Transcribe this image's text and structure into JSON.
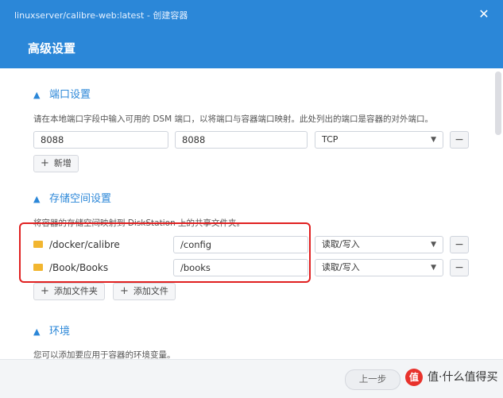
{
  "window": {
    "title": "linuxserver/calibre-web:latest - 创建容器"
  },
  "header": {
    "title": "高级设置"
  },
  "port_section": {
    "title": "端口设置",
    "description": "请在本地端口字段中输入可用的 DSM 端口，以将端口与容器端口映射。此处列出的端口是容器的对外端口。",
    "local_port": "8088",
    "container_port": "8088",
    "protocol": "TCP",
    "add_label": "新增"
  },
  "storage_section": {
    "title": "存储空间设置",
    "description": "将容器的存储空间映射到 DiskStation 上的共享文件夹。",
    "rows": [
      {
        "folder": "/docker/calibre",
        "mount": "/config",
        "mode": "读取/写入"
      },
      {
        "folder": "/Book/Books",
        "mount": "/books",
        "mode": "读取/写入"
      }
    ],
    "add_folder_label": "添加文件夹",
    "add_file_label": "添加文件"
  },
  "env_section": {
    "title": "环境",
    "description": "您可以添加要应用于容器的环境变量。"
  },
  "footer": {
    "prev_label": "上一步"
  },
  "watermark": {
    "text": "值·什么值得买",
    "logo": "值"
  },
  "colors": {
    "accent": "#2b87d8",
    "highlight": "#e02020"
  }
}
